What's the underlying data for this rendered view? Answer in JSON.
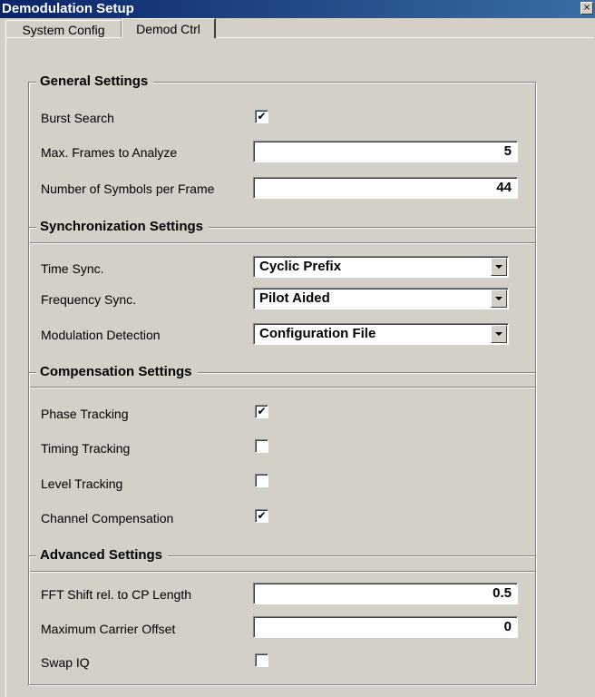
{
  "window": {
    "title": "Demodulation Setup",
    "close_glyph": "×"
  },
  "tabs": [
    {
      "label": "System Config",
      "active": false
    },
    {
      "label": "Demod Ctrl",
      "active": true
    }
  ],
  "general": {
    "title": "General Settings",
    "burst_search": {
      "label": "Burst Search",
      "checked": true
    },
    "max_frames": {
      "label": "Max. Frames to Analyze",
      "value": "5"
    },
    "symbols_per_frame": {
      "label": "Number of Symbols per Frame",
      "value": "44"
    }
  },
  "sync": {
    "title": "Synchronization Settings",
    "time_sync": {
      "label": "Time Sync.",
      "value": "Cyclic Prefix"
    },
    "freq_sync": {
      "label": "Frequency Sync.",
      "value": "Pilot Aided"
    },
    "mod_detect": {
      "label": "Modulation Detection",
      "value": "Configuration File"
    }
  },
  "compensation": {
    "title": "Compensation Settings",
    "phase_tracking": {
      "label": "Phase Tracking",
      "checked": true
    },
    "timing_tracking": {
      "label": "Timing Tracking",
      "checked": false
    },
    "level_tracking": {
      "label": "Level Tracking",
      "checked": false
    },
    "channel_comp": {
      "label": "Channel Compensation",
      "checked": true
    }
  },
  "advanced": {
    "title": "Advanced Settings",
    "fft_shift": {
      "label": "FFT Shift rel. to CP Length",
      "value": "0.5"
    },
    "max_carrier_offset": {
      "label": "Maximum Carrier Offset",
      "value": "0"
    },
    "swap_iq": {
      "label": "Swap IQ",
      "checked": false
    }
  },
  "check_glyph": "✔"
}
